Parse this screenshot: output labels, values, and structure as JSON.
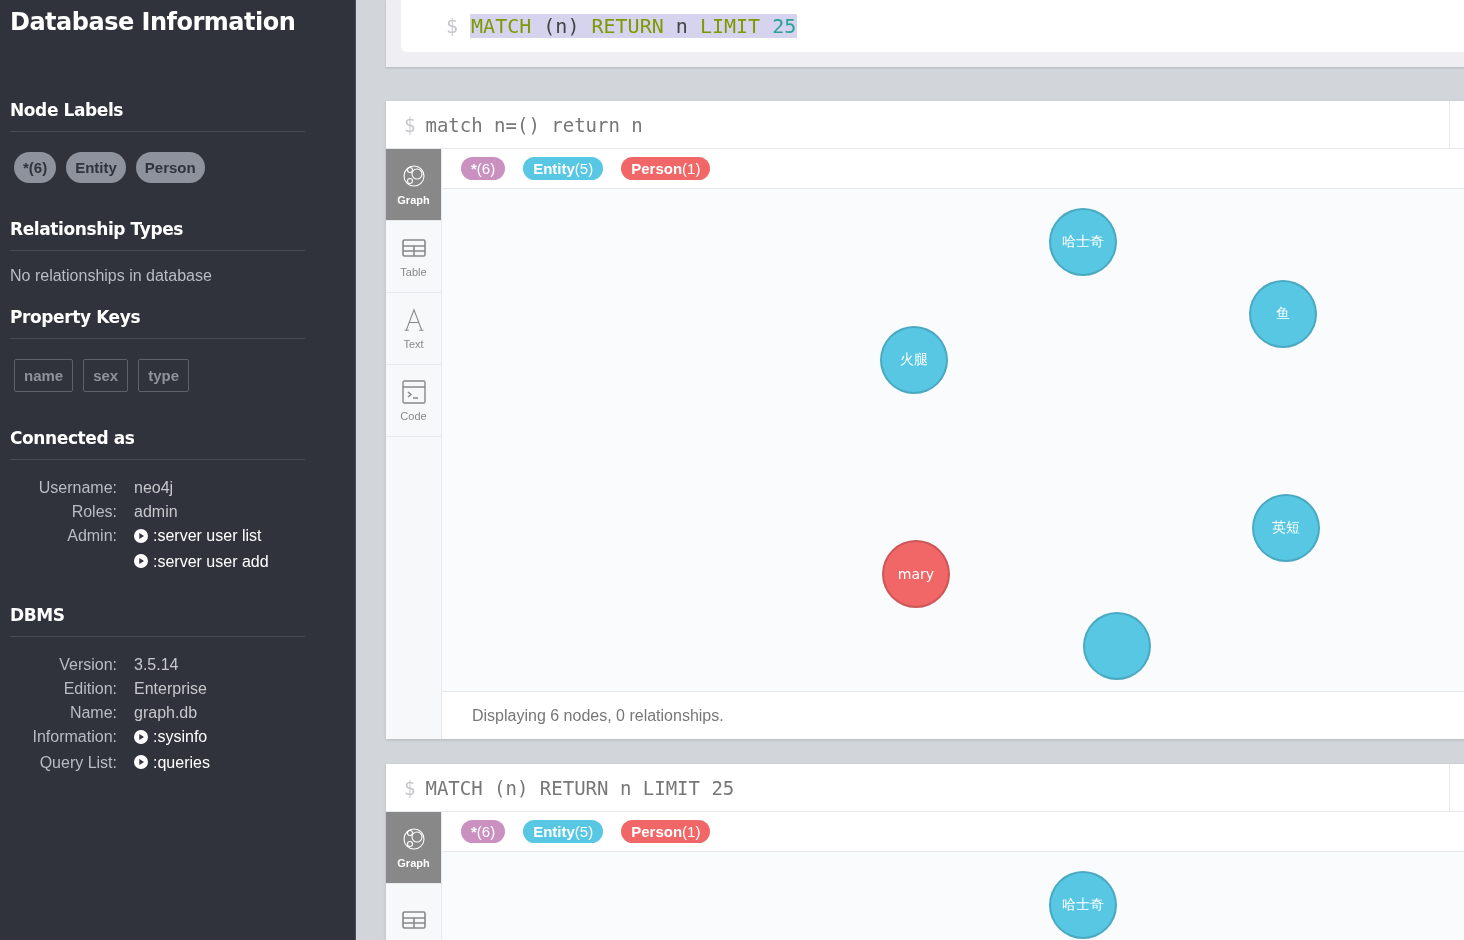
{
  "sidebar": {
    "title": "Database Information",
    "node_labels": {
      "heading": "Node Labels",
      "chips": [
        "*(6)",
        "Entity",
        "Person"
      ]
    },
    "relationship_types": {
      "heading": "Relationship Types",
      "text": "No relationships in database"
    },
    "property_keys": {
      "heading": "Property Keys",
      "keys": [
        "name",
        "sex",
        "type"
      ]
    },
    "connected_as": {
      "heading": "Connected as",
      "rows": [
        {
          "label": "Username:",
          "value": "neo4j",
          "kind": "text"
        },
        {
          "label": "Roles:",
          "value": "admin",
          "kind": "text"
        },
        {
          "label": "Admin:",
          "value": ":server user list",
          "kind": "link"
        },
        {
          "value": ":server user add",
          "kind": "link"
        }
      ]
    },
    "dbms": {
      "heading": "DBMS",
      "rows": [
        {
          "label": "Version:",
          "value": "3.5.14",
          "kind": "text"
        },
        {
          "label": "Edition:",
          "value": "Enterprise",
          "kind": "text"
        },
        {
          "label": "Name:",
          "value": "graph.db",
          "kind": "text"
        },
        {
          "label": "Information:",
          "value": ":sysinfo",
          "kind": "link"
        },
        {
          "label": "Query List:",
          "value": ":queries",
          "kind": "link"
        }
      ]
    }
  },
  "editor": {
    "prompt": "$",
    "selected": true,
    "tokens": [
      {
        "text": "MATCH",
        "kind": "keyword"
      },
      {
        "text": "(n)",
        "kind": "plain"
      },
      {
        "text": "RETURN",
        "kind": "keyword"
      },
      {
        "text": "n",
        "kind": "plain"
      },
      {
        "text": "LIMIT",
        "kind": "keyword"
      },
      {
        "text": "25",
        "kind": "number"
      }
    ]
  },
  "frames": [
    {
      "prompt": "$",
      "query": "match n=() return n",
      "legend": [
        {
          "name": "*",
          "count": "(6)",
          "color": "#c990c0"
        },
        {
          "name": "Entity",
          "count": "(5)",
          "color": "#57c7e3"
        },
        {
          "name": "Person",
          "count": "(1)",
          "color": "#f16667"
        }
      ],
      "tabs": [
        {
          "kind": "graph",
          "label": "Graph",
          "selected": true
        },
        {
          "kind": "table",
          "label": "Table",
          "selected": false
        },
        {
          "kind": "text",
          "label": "Text",
          "selected": false
        },
        {
          "kind": "code",
          "label": "Code",
          "selected": false
        }
      ],
      "nodes": [
        {
          "caption": "哈士奇",
          "color": "#57c7e3"
        },
        {
          "caption": "鱼",
          "color": "#57c7e3"
        },
        {
          "caption": "火腿",
          "color": "#57c7e3"
        },
        {
          "caption": "英短",
          "color": "#57c7e3"
        },
        {
          "caption": "mary",
          "color": "#f16667"
        },
        {
          "color": "#57c7e3"
        }
      ],
      "footer": "Displaying 6 nodes, 0 relationships."
    },
    {
      "prompt": "$",
      "query": "MATCH (n) RETURN n LIMIT 25",
      "legend": [
        {
          "name": "*",
          "count": "(6)",
          "color": "#c990c0"
        },
        {
          "name": "Entity",
          "count": "(5)",
          "color": "#57c7e3"
        },
        {
          "name": "Person",
          "count": "(1)",
          "color": "#f16667"
        }
      ],
      "tabs": [
        {
          "kind": "graph",
          "label": "Graph",
          "selected": true
        },
        {
          "kind": "table",
          "selected": false
        }
      ],
      "nodes": [
        {
          "caption": "哈士奇",
          "color": "#57c7e3"
        }
      ]
    }
  ]
}
